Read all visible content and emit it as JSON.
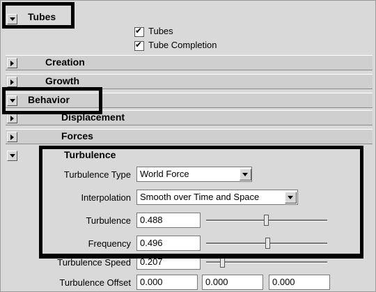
{
  "tubes": {
    "header": "Tubes",
    "checkbox_tubes": "Tubes",
    "checkbox_tube_completion": "Tube Completion"
  },
  "sections": {
    "creation": "Creation",
    "growth": "Growth",
    "behavior": "Behavior",
    "displacement": "Displacement",
    "forces": "Forces",
    "turbulence": "Turbulence"
  },
  "turbulence": {
    "type_label": "Turbulence Type",
    "type_value": "World Force",
    "interpolation_label": "Interpolation",
    "interpolation_value": "Smooth over Time and Space",
    "turbulence_label": "Turbulence",
    "turbulence_value": "0.488",
    "turbulence_slider": 0.488,
    "frequency_label": "Frequency",
    "frequency_value": "0.496",
    "frequency_slider": 0.496,
    "speed_label": "Turbulence Speed",
    "speed_value": "0.207",
    "speed_slider": 0.207,
    "offset_label": "Turbulence Offset",
    "offset_x": "0.000",
    "offset_y": "0.000",
    "offset_z": "0.000"
  }
}
